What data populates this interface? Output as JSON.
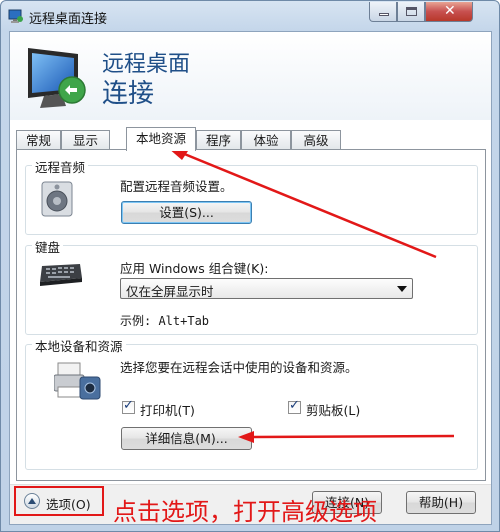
{
  "window": {
    "title": "远程桌面连接",
    "controls": {
      "minimize": "minimize",
      "maximize": "maximize",
      "close": "✕"
    }
  },
  "header": {
    "title_line1": "远程桌面",
    "title_line2": "连接"
  },
  "tabs": [
    {
      "label": "常规"
    },
    {
      "label": "显示"
    },
    {
      "label": "本地资源",
      "active": true
    },
    {
      "label": "程序"
    },
    {
      "label": "体验"
    },
    {
      "label": "高级"
    }
  ],
  "audio": {
    "group_label": "远程音频",
    "description": "配置远程音频设置。",
    "settings_button": "设置(S)..."
  },
  "keyboard": {
    "group_label": "键盘",
    "apply_label": "应用 Windows 组合键(K):",
    "selected": "仅在全屏显示时",
    "example": "示例: Alt+Tab"
  },
  "local": {
    "group_label": "本地设备和资源",
    "description": "选择您要在远程会话中使用的设备和资源。",
    "printer": {
      "label": "打印机(T)",
      "checked": true
    },
    "clipboard": {
      "label": "剪贴板(L)",
      "checked": true
    },
    "details_button": "详细信息(M)..."
  },
  "footer": {
    "options_label": "选项(O)",
    "annotation": "点击选项，打开高级选项",
    "connect_button": "连接(N)",
    "help_button": "帮助(H)"
  },
  "colors": {
    "annotation_red": "#e21818",
    "title_blue": "#1f4f88"
  }
}
